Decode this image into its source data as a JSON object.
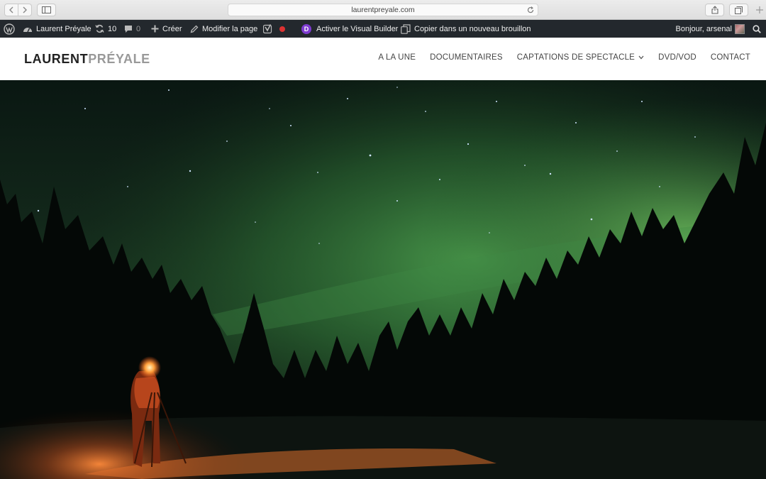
{
  "browser": {
    "url": "laurentpreyale.com"
  },
  "admin_bar": {
    "site_name": "Laurent Préyale",
    "updates_count": "10",
    "comments_count": "0",
    "create_label": "Créer",
    "edit_page_label": "Modifier la page",
    "visual_builder_label": "Activer le Visual Builder",
    "divi_letter": "D",
    "copy_draft_label": "Copier dans un nouveau brouillon",
    "greeting": "Bonjour, arsenal"
  },
  "site": {
    "logo_first": "LAURENT",
    "logo_last": "PRÉYALE",
    "nav": [
      "A LA UNE",
      "DOCUMENTAIRES",
      "CAPTATIONS DE SPECTACLE",
      "DVD/VOD",
      "CONTACT"
    ]
  },
  "hero": {
    "image": "northern-lights-photographer"
  },
  "colors": {
    "admin_bar": "#23282d",
    "divi_purple": "#7e3bd0",
    "recording_red": "#dc3232",
    "aurora_green": "#3f8a45"
  }
}
